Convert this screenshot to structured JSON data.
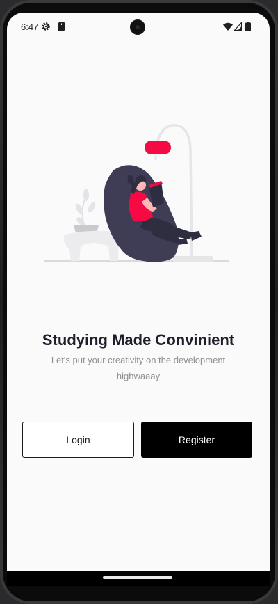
{
  "status_bar": {
    "time": "6:47",
    "icons": [
      "settings-gear-icon",
      "sd-card-icon",
      "wifi-icon",
      "cellular-signal-icon",
      "battery-icon"
    ]
  },
  "illustration": {
    "name": "woman-reading-on-bean-bag",
    "accent_color": "#f50a44",
    "dark_color": "#3f3d56"
  },
  "onboarding": {
    "headline": "Studying Made Convinient",
    "subtitle": "Let's put your creativity on the development highwaaay"
  },
  "buttons": {
    "login_label": "Login",
    "register_label": "Register"
  },
  "colors": {
    "background": "#fafafa",
    "primary": "#000000",
    "text": "#1f1f2b",
    "muted_text": "#8e8e93"
  }
}
